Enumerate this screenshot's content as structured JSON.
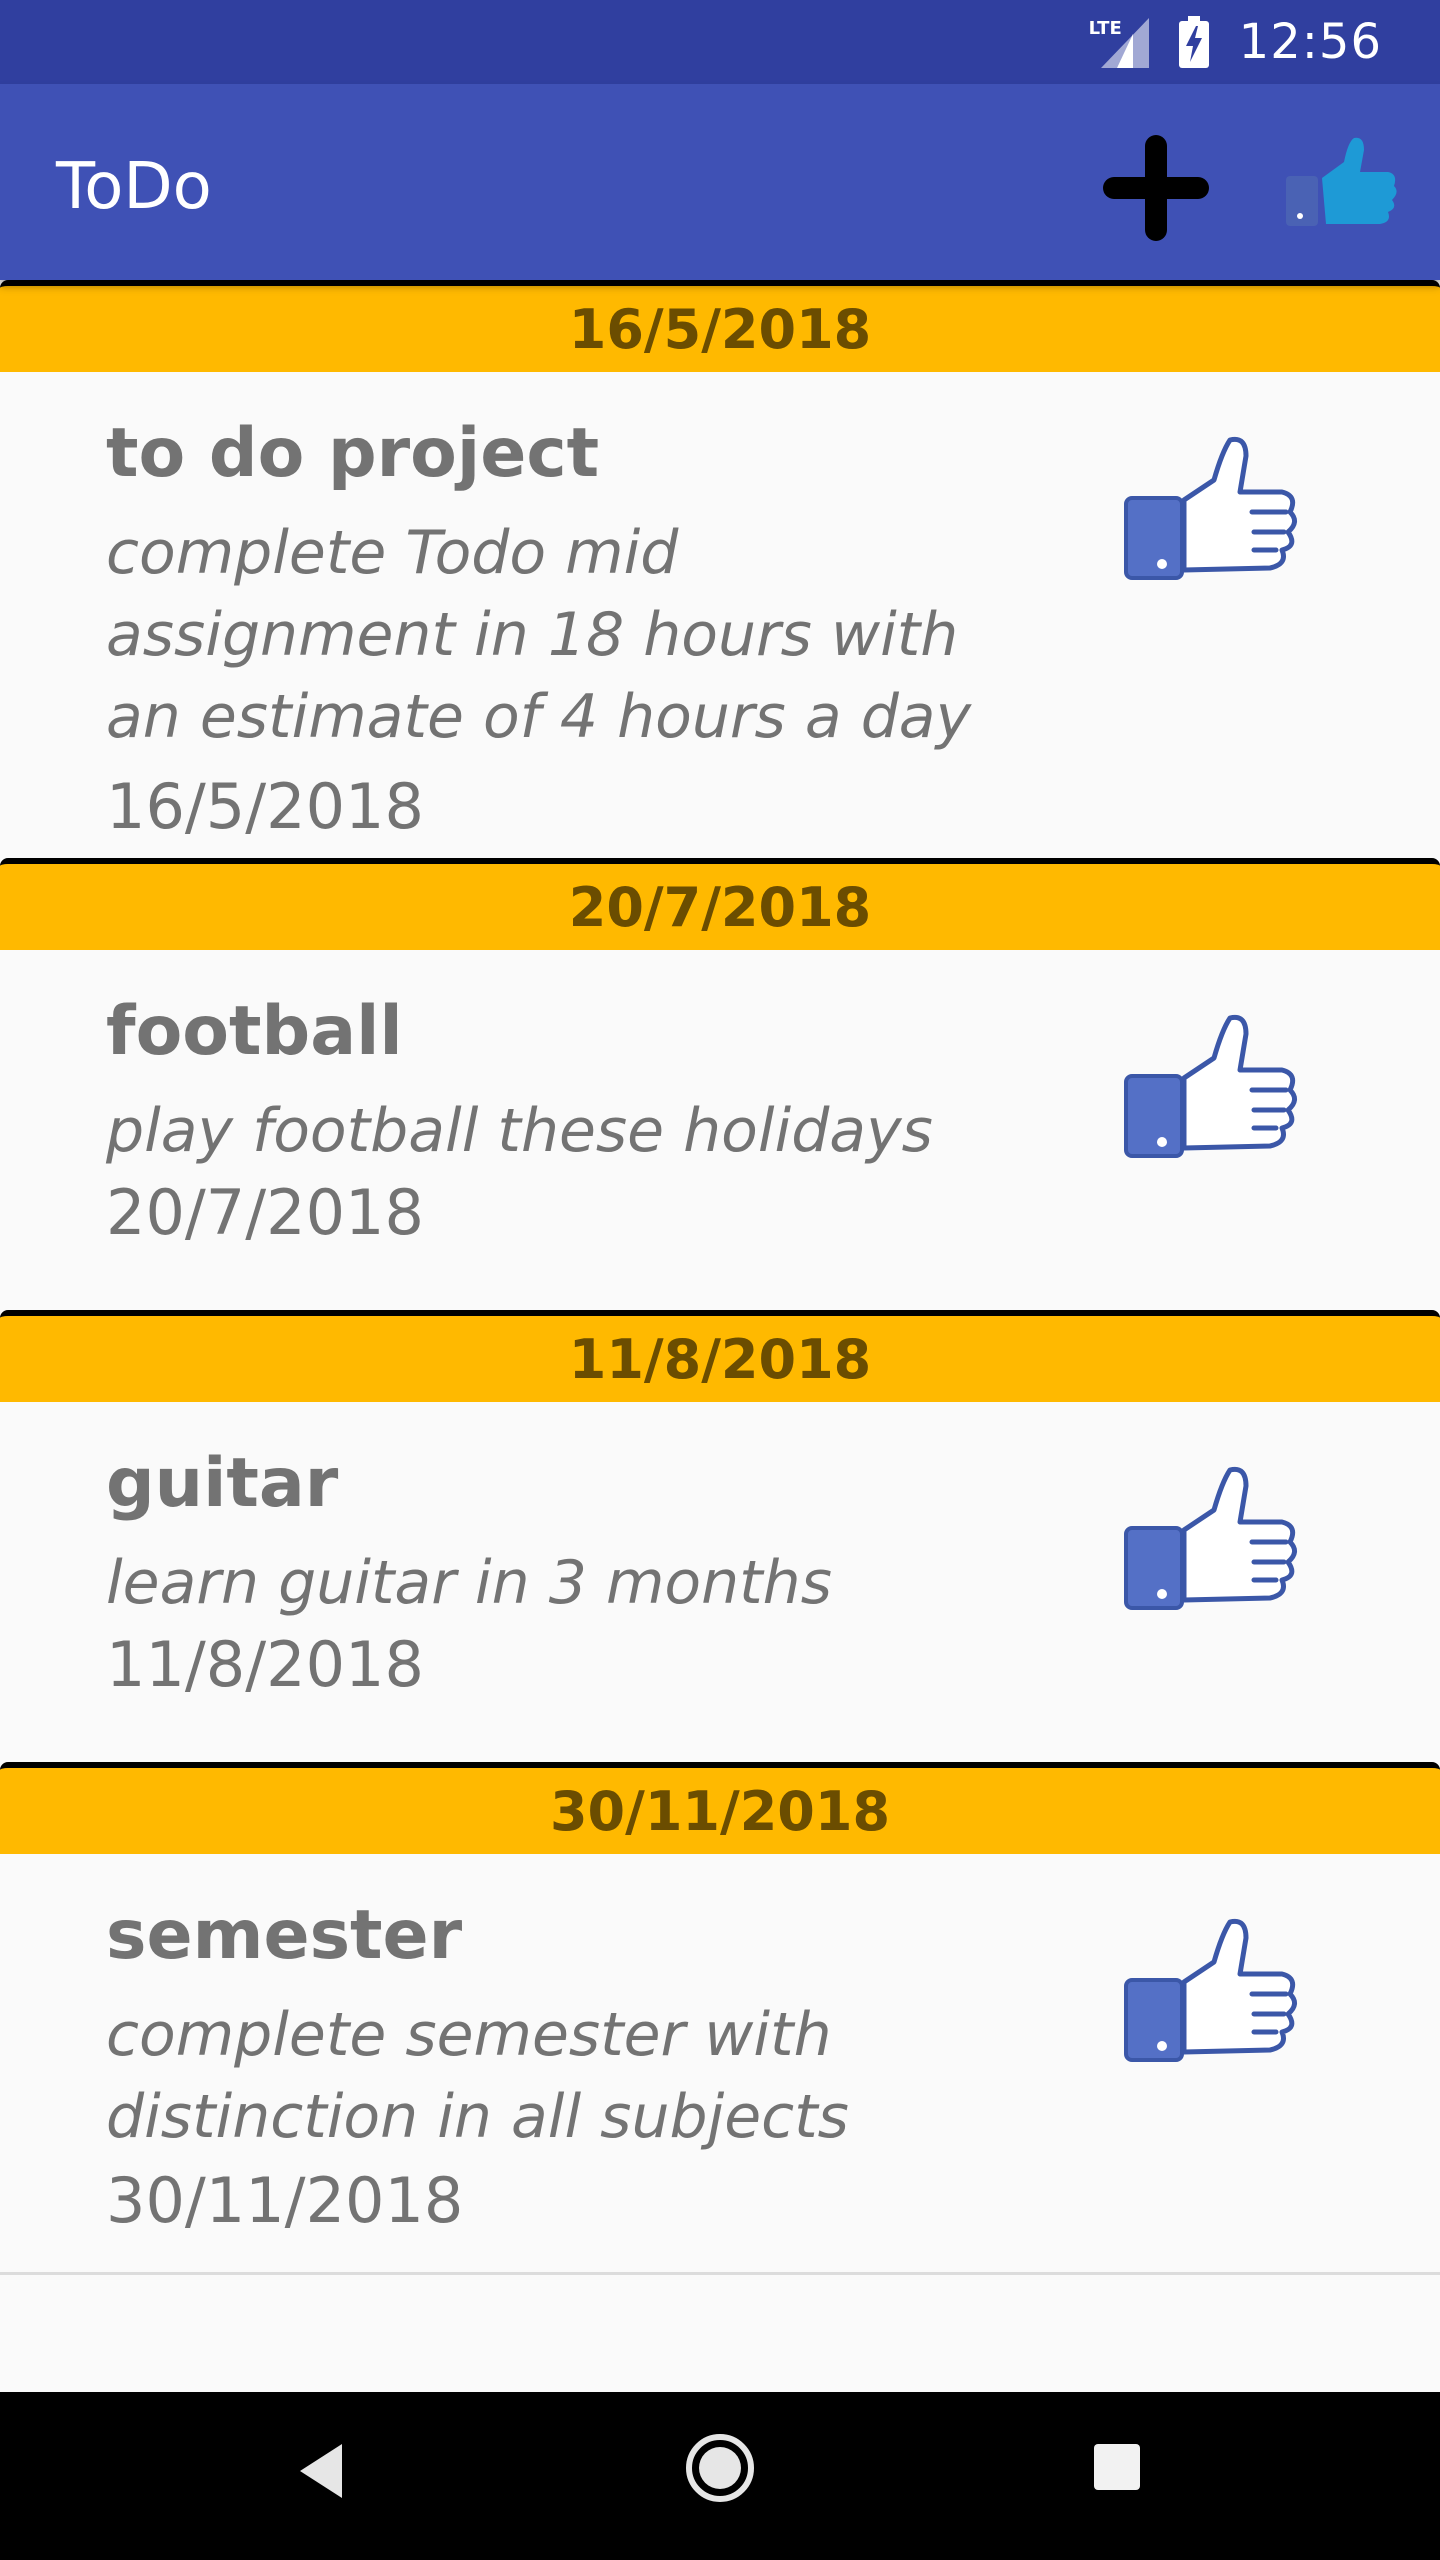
{
  "status_bar": {
    "network_label": "LTE",
    "time": "12:56"
  },
  "app_bar": {
    "title": "ToDo",
    "actions": [
      {
        "icon": "add-icon"
      },
      {
        "icon": "thumbs-up-icon"
      }
    ]
  },
  "todos": [
    {
      "header_date": "16/5/2018",
      "title": "to do project",
      "description_lines": [
        "complete Todo mid",
        "assignment in 18 hours with",
        "an estimate of 4 hours a day"
      ],
      "date": "16/5/2018",
      "icon": "thumbs-up-icon"
    },
    {
      "header_date": "20/7/2018",
      "title": "football",
      "description_lines": [
        "play football these holidays"
      ],
      "date": "20/7/2018",
      "icon": "thumbs-up-icon"
    },
    {
      "header_date": "11/8/2018",
      "title": "guitar",
      "description_lines": [
        "learn guitar in 3 months"
      ],
      "date": "11/8/2018",
      "icon": "thumbs-up-icon"
    },
    {
      "header_date": "30/11/2018",
      "title": "semester",
      "description_lines": [
        "complete semester with",
        "distinction in all subjects"
      ],
      "date": "30/11/2018",
      "icon": "thumbs-up-icon"
    }
  ],
  "colors": {
    "status_bar": "#303f9f",
    "app_bar": "#3f51b5",
    "date_header": "#ffb900",
    "thumb_blue": "#4a62b4"
  }
}
